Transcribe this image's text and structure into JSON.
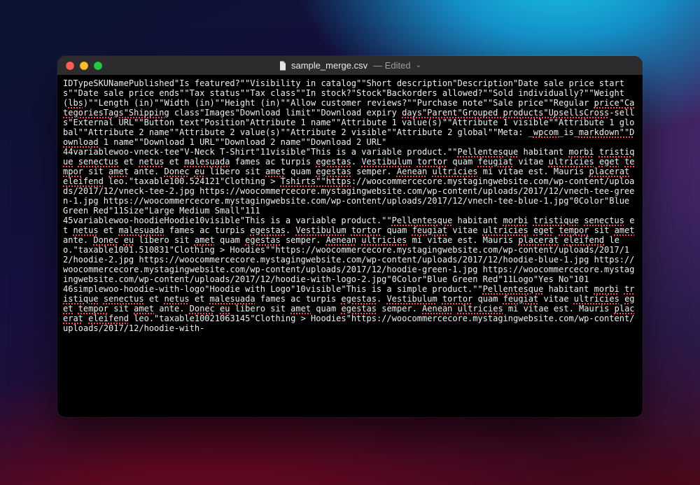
{
  "window": {
    "filename": "sample_merge.csv",
    "status": "Edited"
  },
  "text": {
    "l1a": "IDTypeSKUNamePublished\"Is featured?\"\"Visibility in catalog\"\"Short description\"Description\"Date sale price starts\"\"Date sale price ends\"\"Tax status\"\"Tax class\"\"In stock?\"Stock\"Backorders allowed?\"\"Sold individually?\"\"Weight (",
    "l1b": "lbs",
    "l1c": ")\"\"Length (in)\"\"Width (in)\"\"Height (in)\"\"Allow customer reviews?\"\"Purchase note\"\"Sale price\"\"Regular ",
    "l1d": "price\"CategoriesTags\"Shipping",
    "l1e": " class\"Images\"Download limit\"\"Download expiry ",
    "l1f": "days\"Parent\"Grouped products\"UpsellsCross",
    "l1g": "-sells\"External URL\"\"Button text\"Position\"Attribute 1 name\"\"Attribute 1 value(s)\"\"Attribute 1 visible\"\"Attribute 1 global\"\"Attribute 2 name\"\"Attribute 2 value(s)\"\"Attribute 2 visible\"\"Attribute 2 global\"\"Meta: _",
    "l1h": "wpcom",
    "l1i": "_is_",
    "l1j": "markdown\"\"Download",
    "l1k": " 1 name\"\"Download 1 URL\"\"Download 2 name\"\"Download 2 URL\"",
    "l2a": "44variablewoo-vneck-tee\"V-Neck T-Shirt\"11visible\"This is a variable product.\"\"",
    "l2b": "Pellentesque",
    "l2c": " habitant ",
    "l2d": "morbi",
    "l2e": " ",
    "l2f": "tristique",
    "l2g": " ",
    "l2h": "senectus",
    "l2i": " et ",
    "l2j": "netus",
    "l2k": " et ",
    "l2l": "malesuada",
    "l2m": " fames ac turpis ",
    "l2n": "egestas",
    "l2o": ". ",
    "l2p": "Vestibulum",
    "l2q": " ",
    "l2r": "tortor",
    "l2s": " quam ",
    "l2t": "feugiat",
    "l2u": " vitae ",
    "l2v": "ultricies",
    "l2w": " ",
    "l2x": "eget",
    "l2y": " ",
    "l2z": "tempor",
    "l2aa": " sit ",
    "l2ab": "amet",
    "l2ac": " ante. ",
    "l2ad": "Donec",
    "l2ae": " ",
    "l2af": "eu",
    "l2ag": " libero sit ",
    "l2ah": "amet",
    "l2ai": " quam ",
    "l2aj": "egestas",
    "l2ak": " semper. ",
    "l2al": "Aenean",
    "l2am": " ",
    "l2an": "ultricies",
    "l2ao": " mi vitae est. Mauris ",
    "l2ap": "placerat",
    "l2aq": " ",
    "l2ar": "eleifend",
    "l2as": " leo.\"taxable100.524121\"Clothing > ",
    "l2at": "Tshirts\"\"https",
    "l2au": "://woocommercecore.mystagingwebsite.com/wp-content/uploads/2017/12/vneck-tee-2.jpg https://woocommercecore.mystagingwebsite.com/wp-content/uploads/2017/12/vnech-tee-green-1.jpg https://woocommercecore.mystagingwebsite.com/wp-content/uploads/2017/12/vnech-tee-blue-1.jpg\"0Color\"Blue Green Red\"11Size\"Large Medium Small\"111",
    "l3a": "45variablewoo-hoodieHoodie10visible\"This is a variable product.\"\"",
    "l3b": "Pellentesque",
    "l3c": " habitant ",
    "l3d": "morbi",
    "l3e": " ",
    "l3f": "tristique",
    "l3g": " ",
    "l3h": "senectus",
    "l3i": " et ",
    "l3j": "netus",
    "l3k": " et ",
    "l3l": "malesuada",
    "l3m": " fames ac turpis ",
    "l3n": "egestas",
    "l3o": ". ",
    "l3p": "Vestibulum",
    "l3q": " ",
    "l3r": "tortor",
    "l3s": " quam ",
    "l3t": "feugiat",
    "l3u": " vitae ",
    "l3v": "ultricies",
    "l3w": " ",
    "l3x": "eget",
    "l3y": " ",
    "l3z": "tempor",
    "l3aa": " sit ",
    "l3ab": "amet",
    "l3ac": " ante. ",
    "l3ad": "Donec",
    "l3ae": " ",
    "l3af": "eu",
    "l3ag": " libero sit ",
    "l3ah": "amet",
    "l3ai": " quam ",
    "l3aj": "egestas",
    "l3ak": " semper. ",
    "l3al": "Aenean",
    "l3am": " ",
    "l3an": "ultricies",
    "l3ao": " mi vitae est. Mauris ",
    "l3ap": "placerat",
    "l3aq": " ",
    "l3ar": "eleifend",
    "l3as": " leo.\"taxable1001.510831\"Clothing > Hoodies\"\"https://woocommercecore.mystagingwebsite.com/wp-content/uploads/2017/12/hoodie-2.jpg https://woocommercecore.mystagingwebsite.com/wp-content/uploads/2017/12/hoodie-blue-1.jpg https://woocommercecore.mystagingwebsite.com/wp-content/uploads/2017/12/hoodie-green-1.jpg https://woocommercecore.mystagingwebsite.com/wp-content/uploads/2017/12/hoodie-with-logo-2.jpg\"0Color\"Blue Green Red\"11Logo\"Yes No\"101",
    "l4a": "46simplewoo-hoodie-with-logo\"Hoodie with Logo\"10visible\"This is a simple product.\"\"",
    "l4b": "Pellentesque",
    "l4c": " habitant ",
    "l4d": "morbi",
    "l4e": " ",
    "l4f": "tristique",
    "l4g": " ",
    "l4h": "senectus",
    "l4i": " et ",
    "l4j": "netus",
    "l4k": " et ",
    "l4l": "malesuada",
    "l4m": " fames ac turpis ",
    "l4n": "egestas",
    "l4o": ". ",
    "l4p": "Vestibulum",
    "l4q": " ",
    "l4r": "tortor",
    "l4s": " quam ",
    "l4t": "feugiat",
    "l4u": " vitae ",
    "l4v": "ultricies",
    "l4w": " ",
    "l4x": "eget",
    "l4y": " ",
    "l4z": "tempor",
    "l4aa": " sit ",
    "l4ab": "amet",
    "l4ac": " ante. ",
    "l4ad": "Donec",
    "l4ae": " ",
    "l4af": "eu",
    "l4ag": " libero sit ",
    "l4ah": "amet",
    "l4ai": " quam ",
    "l4aj": "egestas",
    "l4ak": " semper. ",
    "l4al": "Aenean",
    "l4am": " ",
    "l4an": "ultricies",
    "l4ao": " mi vitae est. Mauris ",
    "l4ap": "placerat",
    "l4aq": " ",
    "l4ar": "eleifend",
    "l4as": " leo.\"taxable10021063145\"Clothing > Hoodies\"https://woocommercecore.mystagingwebsite.com/wp-content/uploads/2017/12/hoodie-with-"
  }
}
